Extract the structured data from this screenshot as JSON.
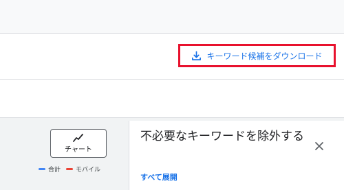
{
  "download": {
    "label": "キーワード候補をダウンロード",
    "icon": "download-icon",
    "color": "#1a73e8",
    "highlight_color": "#e8112d"
  },
  "chart_toggle": {
    "label": "チャート",
    "icon": "trend-line-icon"
  },
  "legend": [
    {
      "label": "合計",
      "color": "#4285f4"
    },
    {
      "label": "モバイル",
      "color": "#ea4335"
    }
  ],
  "panel": {
    "title": "不必要なキーワードを除外する",
    "expand_all_label": "すべて展開",
    "close_icon": "close-icon"
  }
}
